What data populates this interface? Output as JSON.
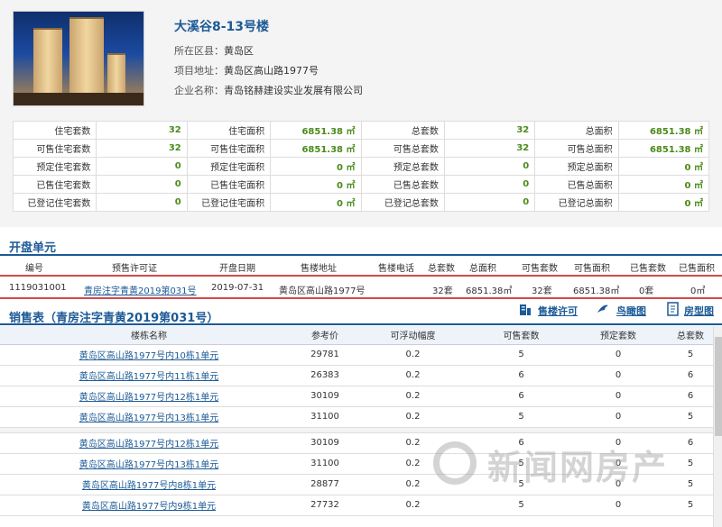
{
  "project": {
    "title": "大溪谷8-13号楼",
    "district_label": "所在区县：",
    "district": "黄岛区",
    "address_label": "项目地址：",
    "address": "黄岛区高山路1977号",
    "company_label": "企业名称：",
    "company": "青岛铭赫建设实业发展有限公司"
  },
  "stats": [
    [
      "住宅套数",
      "32",
      "住宅面积",
      "6851.38 ㎡",
      "总套数",
      "32",
      "总面积",
      "6851.38 ㎡"
    ],
    [
      "可售住宅套数",
      "32",
      "可售住宅面积",
      "6851.38 ㎡",
      "可售总套数",
      "32",
      "可售总面积",
      "6851.38 ㎡"
    ],
    [
      "预定住宅套数",
      "0",
      "预定住宅面积",
      "0 ㎡",
      "预定总套数",
      "0",
      "预定总面积",
      "0 ㎡"
    ],
    [
      "已售住宅套数",
      "0",
      "已售住宅面积",
      "0 ㎡",
      "已售总套数",
      "0",
      "已售总面积",
      "0 ㎡"
    ],
    [
      "已登记住宅套数",
      "0",
      "已登记住宅面积",
      "0 ㎡",
      "已登记总套数",
      "0",
      "已登记总面积",
      "0 ㎡"
    ]
  ],
  "opening": {
    "title": "开盘单元",
    "headers": [
      "编号",
      "预售许可证",
      "开盘日期",
      "售楼地址",
      "售楼电话",
      "总套数",
      "总面积",
      "可售套数",
      "可售面积",
      "已售套数",
      "已售面积"
    ],
    "row": {
      "id": "1119031001",
      "permit": "青房注字青黄2019第031号",
      "date": "2019-07-31",
      "address": "黄岛区高山路1977号",
      "phone": "",
      "total": "32套",
      "area": "6851.38㎡",
      "avail": "32套",
      "avail_area": "6851.38㎡",
      "sold": "0套",
      "sold_area": "0㎡"
    }
  },
  "sales": {
    "title": "销售表（青房注字青黄2019第031号）",
    "btn_permit": "售楼许可",
    "btn_aerial": "鸟瞰图",
    "btn_layout": "房型图",
    "headers": [
      "楼栋名称",
      "参考价",
      "可浮动幅度",
      "可售套数",
      "预定套数",
      "总套数"
    ],
    "rows": [
      [
        "黄岛区高山路1977号内10栋1单元",
        "29781",
        "0.2",
        "5",
        "0",
        "5"
      ],
      [
        "黄岛区高山路1977号内11栋1单元",
        "26383",
        "0.2",
        "6",
        "0",
        "6"
      ],
      [
        "黄岛区高山路1977号内12栋1单元",
        "30109",
        "0.2",
        "6",
        "0",
        "6"
      ],
      [
        "黄岛区高山路1977号内13栋1单元",
        "31100",
        "0.2",
        "5",
        "0",
        "5"
      ],
      [
        "黄岛区高山路1977号内12栋1单元",
        "30109",
        "0.2",
        "6",
        "0",
        "6"
      ],
      [
        "黄岛区高山路1977号内13栋1单元",
        "31100",
        "0.2",
        "5",
        "0",
        "5"
      ],
      [
        "黄岛区高山路1977号内8栋1单元",
        "28877",
        "0.2",
        "5",
        "0",
        "5"
      ],
      [
        "黄岛区高山路1977号内9栋1单元",
        "27732",
        "0.2",
        "5",
        "0",
        "5"
      ]
    ]
  },
  "watermark": "新闻网房产"
}
